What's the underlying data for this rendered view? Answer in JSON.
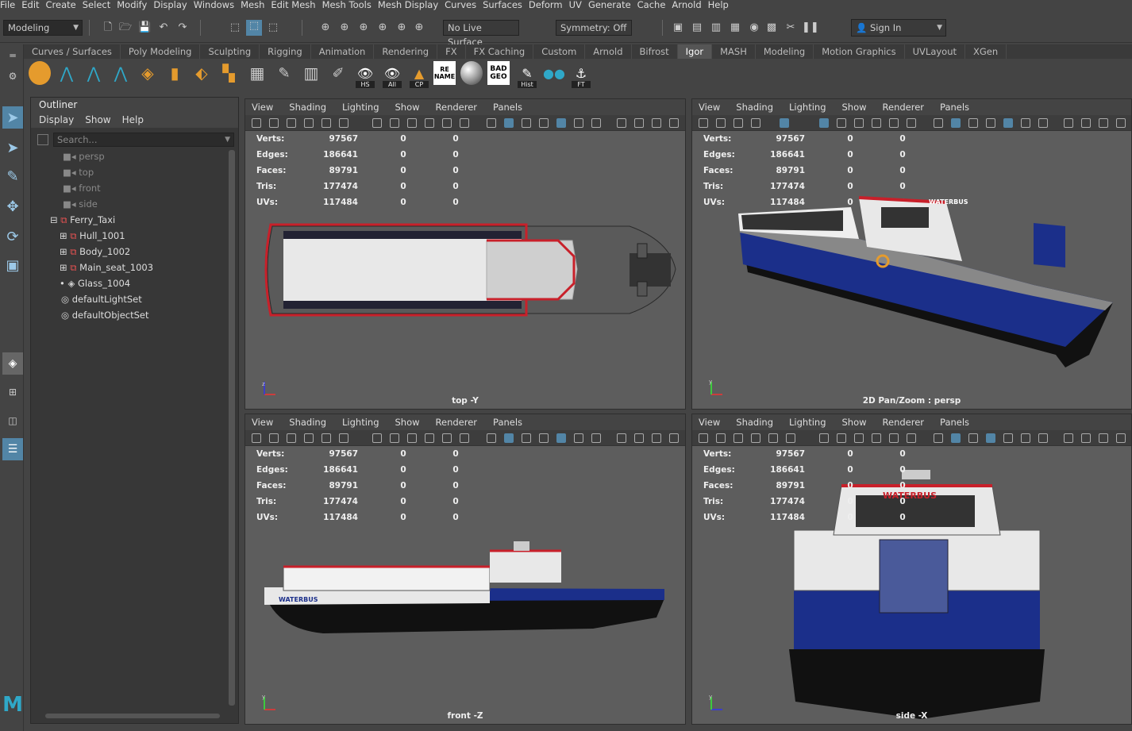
{
  "menubar": [
    "File",
    "Edit",
    "Create",
    "Select",
    "Modify",
    "Display",
    "Windows",
    "Mesh",
    "Edit Mesh",
    "Mesh Tools",
    "Mesh Display",
    "Curves",
    "Surfaces",
    "Deform",
    "UV",
    "Generate",
    "Cache",
    "Arnold",
    "Help"
  ],
  "statusline": {
    "mode": "Modeling",
    "live_surface": "No Live Surface",
    "symmetry": "Symmetry: Off",
    "sign_in": "Sign In"
  },
  "shelf_tabs": [
    "Curves / Surfaces",
    "Poly Modeling",
    "Sculpting",
    "Rigging",
    "Animation",
    "Rendering",
    "FX",
    "FX Caching",
    "Custom",
    "Arnold",
    "Bifrost",
    "Igor",
    "MASH",
    "Modeling",
    "Motion Graphics",
    "UVLayout",
    "XGen"
  ],
  "active_shelf_tab": "Igor",
  "shelf_labels": {
    "hs": "HS",
    "all": "All",
    "cp": "CP",
    "rename": "RE NAME",
    "badgeo": "BAD GEO",
    "hist": "Hist",
    "ft": "FT"
  },
  "outliner": {
    "title": "Outliner",
    "menu": [
      "Display",
      "Show",
      "Help"
    ],
    "search_placeholder": "Search...",
    "items": [
      {
        "label": "persp",
        "type": "camera"
      },
      {
        "label": "top",
        "type": "camera"
      },
      {
        "label": "front",
        "type": "camera"
      },
      {
        "label": "side",
        "type": "camera"
      },
      {
        "label": "Ferry_Taxi",
        "type": "group"
      },
      {
        "label": "Hull_1001",
        "type": "mesh"
      },
      {
        "label": "Body_1002",
        "type": "mesh"
      },
      {
        "label": "Main_seat_1003",
        "type": "mesh"
      },
      {
        "label": "Glass_1004",
        "type": "mesh"
      },
      {
        "label": "defaultLightSet",
        "type": "set"
      },
      {
        "label": "defaultObjectSet",
        "type": "set"
      }
    ]
  },
  "viewport_menu": [
    "View",
    "Shading",
    "Lighting",
    "Show",
    "Renderer",
    "Panels"
  ],
  "hud": {
    "labels": [
      "Verts:",
      "Edges:",
      "Faces:",
      "Tris:",
      "UVs:"
    ],
    "values": [
      "97567",
      "186641",
      "89791",
      "177474",
      "117484"
    ],
    "zero": "0"
  },
  "viewports": [
    {
      "camera": "top -Y"
    },
    {
      "camera": "2D Pan/Zoom : persp"
    },
    {
      "camera": "front -Z"
    },
    {
      "camera": "side -X"
    }
  ],
  "boat": {
    "name": "WATERBUS"
  },
  "colors": {
    "hull_blue": "#1b2f8a",
    "accent_red": "#c8202a",
    "ui_highlight": "#5285a6"
  }
}
